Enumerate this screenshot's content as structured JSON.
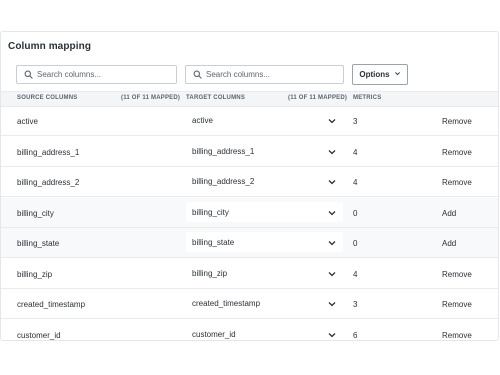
{
  "panel": {
    "title": "Column mapping",
    "source_search_placeholder": "Search columns...",
    "target_search_placeholder": "Search columns...",
    "options_label": "Options"
  },
  "header": {
    "source": "SOURCE COLUMNS",
    "source_count": "(11 OF 11 MAPPED)",
    "target": "TARGET COLUMNS",
    "target_count": "(11 OF 11 MAPPED)",
    "metrics": "METRICS"
  },
  "rows": [
    {
      "source": "active",
      "target": "active",
      "metric": "3",
      "action": "Remove"
    },
    {
      "source": "billing_address_1",
      "target": "billing_address_1",
      "metric": "4",
      "action": "Remove"
    },
    {
      "source": "billing_address_2",
      "target": "billing_address_2",
      "metric": "4",
      "action": "Remove"
    },
    {
      "source": "billing_city",
      "target": "billing_city",
      "metric": "0",
      "action": "Add"
    },
    {
      "source": "billing_state",
      "target": "billing_state",
      "metric": "0",
      "action": "Add"
    },
    {
      "source": "billing_zip",
      "target": "billing_zip",
      "metric": "4",
      "action": "Remove"
    },
    {
      "source": "created_timestamp",
      "target": "created_timestamp",
      "metric": "3",
      "action": "Remove"
    },
    {
      "source": "customer_id",
      "target": "customer_id",
      "metric": "6",
      "action": "Remove"
    }
  ]
}
